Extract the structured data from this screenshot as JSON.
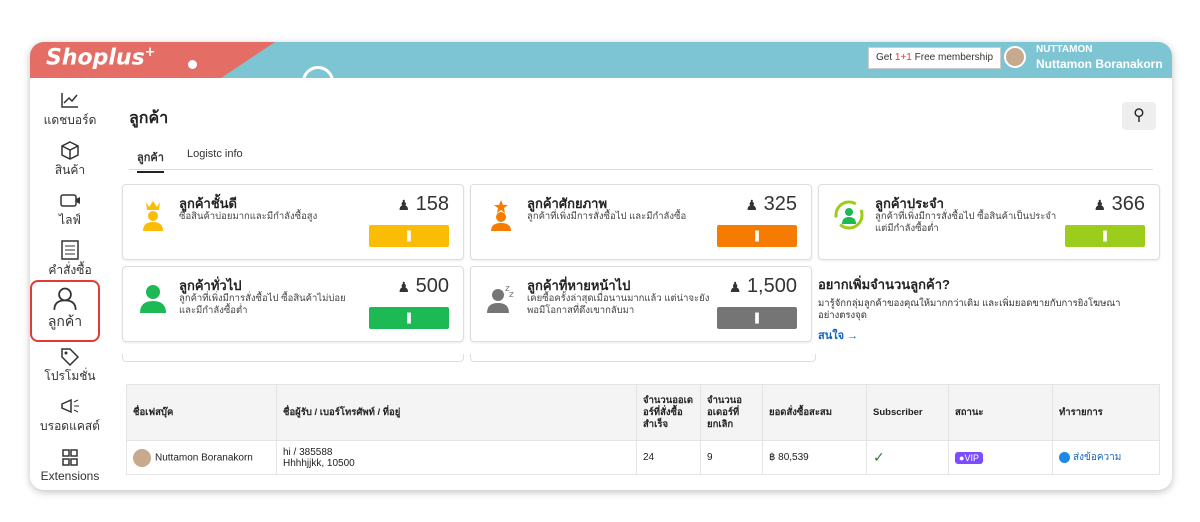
{
  "header": {
    "logo": "Shoplus",
    "logo_sup": "+",
    "membership_prefix": "Get ",
    "membership_highlight": "1+1",
    "membership_suffix": " Free membership",
    "user_label": "NUTTAMON",
    "user_name": "Nuttamon Boranakorn"
  },
  "sidebar": {
    "items": [
      {
        "label": "แดชบอร์ด",
        "icon": "chart-icon"
      },
      {
        "label": "สินค้า",
        "icon": "box-icon"
      },
      {
        "label": "ไลฟ์",
        "icon": "live-icon"
      },
      {
        "label": "คำสั่งซื้อ",
        "icon": "order-list-icon"
      },
      {
        "label": "ลูกค้า",
        "icon": "user-icon"
      },
      {
        "label": "โปรโมชั่น",
        "icon": "tag-icon"
      },
      {
        "label": "บรอดแคสต์",
        "icon": "megaphone-icon"
      },
      {
        "label": "Extensions",
        "icon": "grid-icon"
      }
    ]
  },
  "page": {
    "title": "ลูกค้า",
    "tabs": [
      "ลูกค้า",
      "Logistc info"
    ]
  },
  "segments": [
    {
      "title": "ลูกค้าชั้นดี",
      "desc": "ซื้อสินค้าบ่อยมากและมีกำลังซื้อสูง",
      "count": "158",
      "color": "#fbbc05"
    },
    {
      "title": "ลูกค้าศักยภาพ",
      "desc": "ลูกค้าที่เพิ่งมีการสั่งซื้อไป และมีกำลังซื้อ",
      "count": "325",
      "color": "#f57c00"
    },
    {
      "title": "ลูกค้าประจำ",
      "desc": "ลูกค้าที่เพิ่งมีการสั่งซื้อไป ซื้อสินค้าเป็นประจำแต่มีกำลังซื้อต่ำ",
      "count": "366",
      "color": "#9ccc1c"
    },
    {
      "title": "ลูกค้าทั่วไป",
      "desc": "ลูกค้าที่เพิ่งมีการสั่งซื้อไป ซื้อสินค้าไม่บ่อย และมีกำลังซื้อต่ำ",
      "count": "500",
      "color": "#1db954"
    },
    {
      "title": "ลูกค้าที่หายหน้าไป",
      "desc": "เคยซื้อครั้งล่าสุดเมื่อนานมากแล้ว แต่น่าจะยังพอมีโอกาสที่ดึงเขากลับมา",
      "count": "1,500",
      "color": "#757575"
    }
  ],
  "segment_button_label": "❚",
  "promo": {
    "title": "อยากเพิ่มจำนวนลูกค้า?",
    "desc": "มารู้จักกลุ่มลูกค้าของคุณให้มากกว่าเดิม และเพิ่มยอดขายกับการยิงโฆษณาอย่างตรงจุด",
    "link": "สนใจ →"
  },
  "table": {
    "headers": [
      "ชื่อเฟสบุ๊ค",
      "ชื่อผู้รับ / เบอร์โทรศัพท์ / ที่อยู่",
      "จำนวนออเดอร์ที่สั่งซื้อสำเร็จ",
      "จำนวนออเดอร์ที่ยกเลิก",
      "ยอดสั่งซื้อสะสม",
      "Subscriber",
      "สถานะ",
      "ทำรายการ"
    ],
    "rows": [
      {
        "name": "Nuttamon Boranakorn",
        "recipient": "hi / 385588",
        "address": "Hhhhjjkk, 10500",
        "success": "24",
        "cancel": "9",
        "total": "฿ 80,539",
        "status": "VIP",
        "action": "ส่งข้อความ"
      }
    ]
  }
}
